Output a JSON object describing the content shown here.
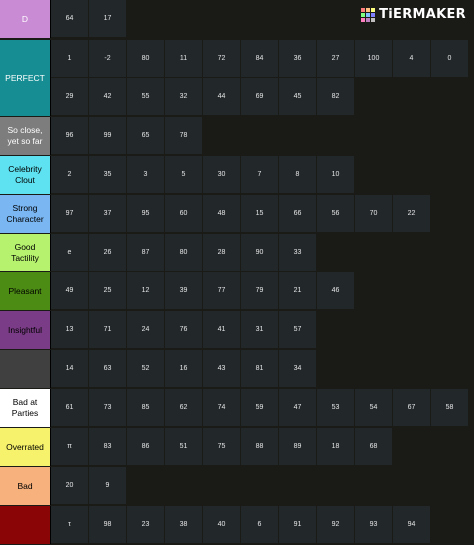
{
  "app": {
    "logo_text": "TiERMAKER",
    "logo_colors": [
      "#ff7f7f",
      "#ffbf7f",
      "#ffff7f",
      "#7fff7f",
      "#7fbfff",
      "#7f7fff",
      "#ff7fbf",
      "#bf7fbf",
      "#bfbfbf"
    ]
  },
  "tiers": [
    {
      "label": "D",
      "color": "#c98bd4",
      "text_color": "#ffffff",
      "items": [
        "64",
        "17"
      ]
    },
    {
      "label": "PERFECT",
      "color": "#168d93",
      "text_color": "#ffffff",
      "items": [
        "1",
        "-2",
        "80",
        "11",
        "72",
        "84",
        "36",
        "27",
        "100",
        "4",
        "0",
        "29",
        "42",
        "55",
        "32",
        "44",
        "69",
        "45",
        "82"
      ]
    },
    {
      "label": "So close, yet so far",
      "color": "#7d7d7d",
      "text_color": "#ffffff",
      "items": [
        "96",
        "99",
        "65",
        "78"
      ]
    },
    {
      "label": "Celebrity Clout",
      "color": "#5ee1f0",
      "text_color": "#000000",
      "items": [
        "2",
        "35",
        "3",
        "5",
        "30",
        "7",
        "8",
        "10"
      ]
    },
    {
      "label": "Strong Character",
      "color": "#79b6f2",
      "text_color": "#000000",
      "items": [
        "97",
        "37",
        "95",
        "60",
        "48",
        "15",
        "66",
        "56",
        "70",
        "22"
      ]
    },
    {
      "label": "Good Tactility",
      "color": "#b6f26e",
      "text_color": "#000000",
      "items": [
        "e",
        "26",
        "87",
        "80",
        "28",
        "90",
        "33"
      ]
    },
    {
      "label": "Pleasant",
      "color": "#4c8c14",
      "text_color": "#000000",
      "items": [
        "49",
        "25",
        "12",
        "39",
        "77",
        "79",
        "21",
        "46"
      ]
    },
    {
      "label": "Insightful",
      "color": "#7a3c86",
      "text_color": "#000000",
      "items": [
        "13",
        "71",
        "24",
        "76",
        "41",
        "31",
        "57"
      ]
    },
    {
      "label": "",
      "color": "#404040",
      "text_color": "#000000",
      "items": [
        "14",
        "63",
        "52",
        "16",
        "43",
        "81",
        "34"
      ]
    },
    {
      "label": "Bad at Parties",
      "color": "#ffffff",
      "text_color": "#000000",
      "items": [
        "61",
        "73",
        "85",
        "62",
        "74",
        "59",
        "47",
        "53",
        "54",
        "67",
        "58"
      ]
    },
    {
      "label": "Overrated",
      "color": "#f7f26b",
      "text_color": "#000000",
      "items": [
        "π",
        "83",
        "86",
        "51",
        "75",
        "88",
        "89",
        "18",
        "68"
      ]
    },
    {
      "label": "Bad",
      "color": "#f6b17d",
      "text_color": "#000000",
      "items": [
        "20",
        "9"
      ]
    },
    {
      "label": "",
      "color": "#8a0606",
      "text_color": "#000000",
      "items": [
        "τ",
        "98",
        "23",
        "38",
        "40",
        "6",
        "91",
        "92",
        "93",
        "94"
      ]
    }
  ]
}
